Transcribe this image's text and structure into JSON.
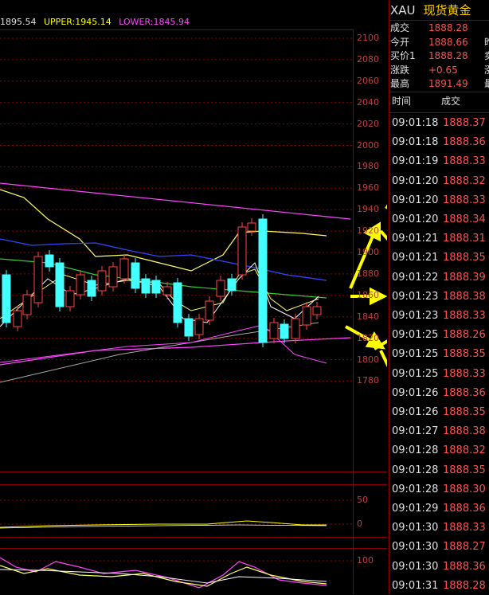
{
  "header": {
    "ma_value": "1895.54",
    "upper": "UPPER:1945.14",
    "lower": "LOWER:1845.94",
    "colors": {
      "ma": "#e0e0e0",
      "upper": "#ffff00",
      "lower": "#ff44ff"
    }
  },
  "price_axis": [
    "2100",
    "2080",
    "2060",
    "2040",
    "2020",
    "2000",
    "1980",
    "1960",
    "1940",
    "1920",
    "1900",
    "1880",
    "1860",
    "1840",
    "1820",
    "1800",
    "1780"
  ],
  "volume_axis": [
    "50",
    "0"
  ],
  "osc_axis": [
    "100"
  ],
  "instrument": {
    "symbol": "XAU",
    "name": "现货黄金"
  },
  "quote": [
    {
      "label": "成交",
      "value": "1888.28",
      "extra": ""
    },
    {
      "label": "今开",
      "value": "1888.66",
      "extra": "昨"
    },
    {
      "label": "买价1",
      "value": "1888.28",
      "extra": "卖"
    },
    {
      "label": "涨跌",
      "value": "+0.65",
      "extra": "涨"
    },
    {
      "label": "最高",
      "value": "1891.49",
      "extra": "最"
    }
  ],
  "ticks_header": {
    "time": "时间",
    "price": "成交"
  },
  "ticks": [
    {
      "time": "09:01:18",
      "price": "1888.37"
    },
    {
      "time": "09:01:18",
      "price": "1888.36"
    },
    {
      "time": "09:01:19",
      "price": "1888.33"
    },
    {
      "time": "09:01:20",
      "price": "1888.32"
    },
    {
      "time": "09:01:20",
      "price": "1888.33"
    },
    {
      "time": "09:01:20",
      "price": "1888.34"
    },
    {
      "time": "09:01:21",
      "price": "1888.31"
    },
    {
      "time": "09:01:21",
      "price": "1888.35"
    },
    {
      "time": "09:01:22",
      "price": "1888.39"
    },
    {
      "time": "09:01:23",
      "price": "1888.38"
    },
    {
      "time": "09:01:23",
      "price": "1888.33"
    },
    {
      "time": "09:01:25",
      "price": "1888.26"
    },
    {
      "time": "09:01:25",
      "price": "1888.35"
    },
    {
      "time": "09:01:25",
      "price": "1888.33"
    },
    {
      "time": "09:01:26",
      "price": "1888.36"
    },
    {
      "time": "09:01:26",
      "price": "1888.35"
    },
    {
      "time": "09:01:27",
      "price": "1888.38"
    },
    {
      "time": "09:01:28",
      "price": "1888.32"
    },
    {
      "time": "09:01:28",
      "price": "1888.35"
    },
    {
      "time": "09:01:28",
      "price": "1888.30"
    },
    {
      "time": "09:01:29",
      "price": "1888.36"
    },
    {
      "time": "09:01:30",
      "price": "1888.33"
    },
    {
      "time": "09:01:30",
      "price": "1888.27"
    },
    {
      "time": "09:01:30",
      "price": "1888.36"
    },
    {
      "time": "09:01:31",
      "price": "1888.28"
    }
  ]
}
